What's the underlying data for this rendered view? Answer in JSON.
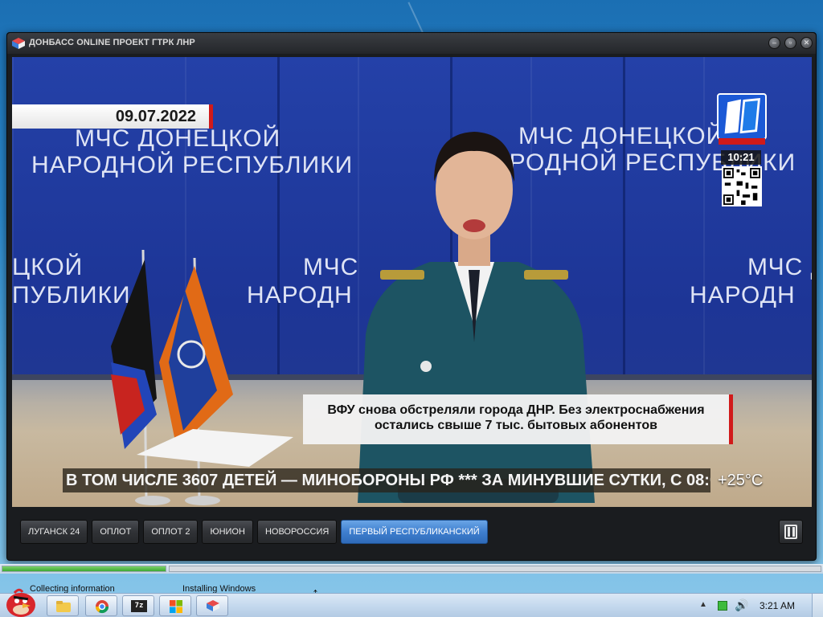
{
  "window": {
    "title": "ДОНБАСС ONLINE ПРОЕКТ ГТРК ЛНР"
  },
  "video": {
    "date": "09.07.2022",
    "background_texts": [
      "МЧС ДОНЕЦКОЙ",
      "НАРОДНОЙ РЕСПУБЛИКИ",
      "МЧС ДОНЕЦКОЙ",
      "НАРОДНОЙ РЕСПУБЛИКИ",
      "ЦКОЙ",
      "ПУБЛИКИ",
      "МЧС",
      "НАРОДН",
      "МЧС Д",
      "НАРОДН"
    ],
    "clock": "10:21",
    "news_line1": "ВФУ снова обстреляли города ДНР. Без электроснабжения",
    "news_line2": "остались свыше 7 тыс. бытовых абонентов",
    "ticker": "В ТОМ ЧИСЛЕ 3607 ДЕТЕЙ — МИНОБОРОНЫ РФ   ***   ЗА МИНУВШИЕ СУТКИ, С 08:0",
    "temperature": "+25°C"
  },
  "channels": [
    {
      "label": "ЛУГАНСК 24",
      "active": false
    },
    {
      "label": "ОПЛОТ",
      "active": false
    },
    {
      "label": "ОПЛОТ 2",
      "active": false
    },
    {
      "label": "ЮНИОН",
      "active": false
    },
    {
      "label": "НОВОРОССИЯ",
      "active": false
    },
    {
      "label": "ПЕРВЫЙ РЕСПУБЛИКАНСКИЙ",
      "active": true
    }
  ],
  "notifications": {
    "left": "Collecting information",
    "right": "Installing Windows"
  },
  "progress": {
    "left_fraction": 1.0,
    "right_fraction": 0.0
  },
  "taskbar": {
    "time": "3:21 AM"
  },
  "colors": {
    "accent_red": "#d11a1a",
    "active_channel": "#3f7fcf"
  }
}
